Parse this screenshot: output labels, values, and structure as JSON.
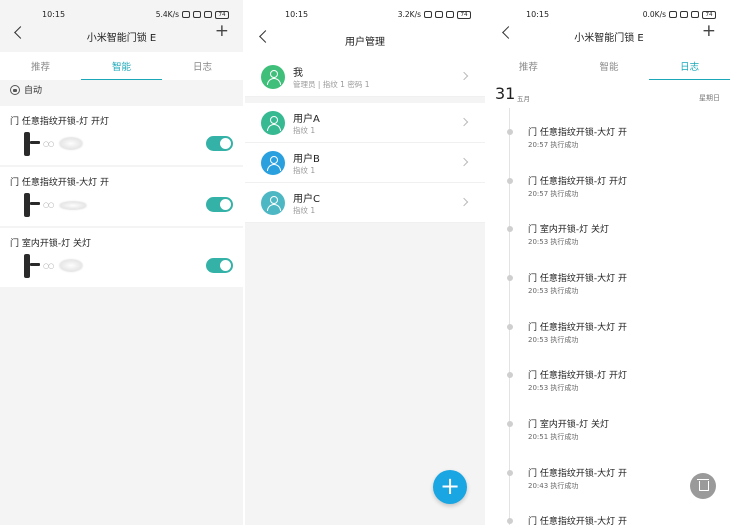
{
  "status": {
    "p1": {
      "time": "10:15",
      "net": "5.4K/s"
    },
    "p2": {
      "time": "10:15",
      "net": "3.2K/s"
    },
    "p3": {
      "time": "10:15",
      "net": "0.0K/s"
    },
    "battery": "74"
  },
  "device_title": "小米智能门锁 E",
  "tabs": [
    "推荐",
    "智能",
    "日志"
  ],
  "smart": {
    "mode_label": "自动",
    "scenes": [
      {
        "label": "门 任意指纹开锁-灯 开灯",
        "enabled": true
      },
      {
        "label": "门 任意指纹开锁-大灯 开",
        "enabled": true
      },
      {
        "label": "门 室内开锁-灯 关灯",
        "enabled": true
      }
    ],
    "link_glyph": "○○"
  },
  "users": {
    "title": "用户管理",
    "admin": {
      "name": "我",
      "sub": "管理员 | 指纹 1 密码 1",
      "color": "#3fbf7a"
    },
    "list": [
      {
        "name": "用户A",
        "sub": "指纹 1",
        "color": "#37b992"
      },
      {
        "name": "用户B",
        "sub": "指纹 1",
        "color": "#2aa0de"
      },
      {
        "name": "用户C",
        "sub": "指纹 1",
        "color": "#4db8c4"
      }
    ],
    "fab": "+"
  },
  "log": {
    "day": "31",
    "month": "五月",
    "weekday": "星期日",
    "entries": [
      {
        "text": "门 任意指纹开锁-大灯 开",
        "time": "20:57",
        "result": "执行成功"
      },
      {
        "text": "门 任意指纹开锁-灯 开灯",
        "time": "20:57",
        "result": "执行成功"
      },
      {
        "text": "门 室内开锁-灯 关灯",
        "time": "20:53",
        "result": "执行成功"
      },
      {
        "text": "门 任意指纹开锁-大灯 开",
        "time": "20:53",
        "result": "执行成功"
      },
      {
        "text": "门 任意指纹开锁-大灯 开",
        "time": "20:53",
        "result": "执行成功"
      },
      {
        "text": "门 任意指纹开锁-灯 开灯",
        "time": "20:53",
        "result": "执行成功"
      },
      {
        "text": "门 室内开锁-灯 关灯",
        "time": "20:51",
        "result": "执行成功"
      },
      {
        "text": "门 任意指纹开锁-大灯 开",
        "time": "20:43",
        "result": "执行成功"
      },
      {
        "text": "门 任意指纹开锁-大灯 开",
        "time": "",
        "result": ""
      }
    ]
  }
}
